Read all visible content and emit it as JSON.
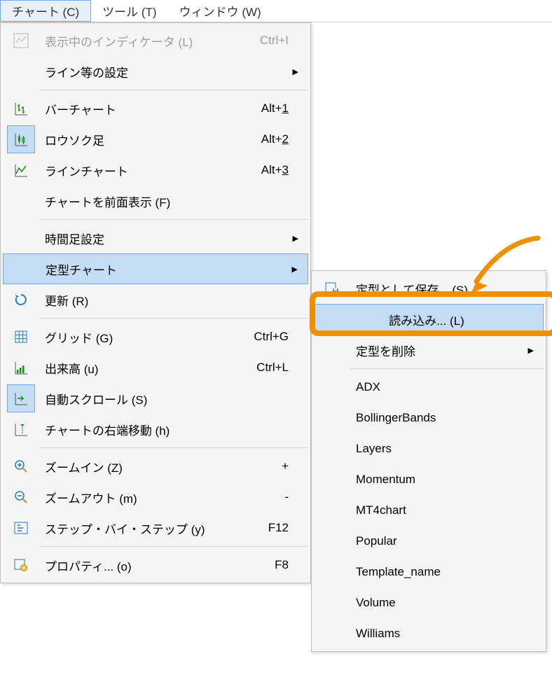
{
  "menubar": {
    "chart": "チャート (C)",
    "tools": "ツール (T)",
    "window": "ウィンドウ (W)"
  },
  "menu": {
    "indicators": {
      "label": "表示中のインディケータ (L)",
      "shortcut": "Ctrl+I"
    },
    "lineSettings": {
      "label": "ライン等の設定"
    },
    "barChart": {
      "label": "バーチャート",
      "shortcut_prefix": "Alt+",
      "shortcut_key": "1"
    },
    "candlestick": {
      "label": "ロウソク足",
      "shortcut_prefix": "Alt+",
      "shortcut_key": "2"
    },
    "lineChart": {
      "label": "ラインチャート",
      "shortcut_prefix": "Alt+",
      "shortcut_key": "3"
    },
    "foreground": {
      "label": "チャートを前面表示 (F)"
    },
    "timeframe": {
      "label": "時間足設定"
    },
    "template": {
      "label": "定型チャート"
    },
    "refresh": {
      "label": "更新 (R)"
    },
    "grid": {
      "label": "グリッド (G)",
      "shortcut": "Ctrl+G"
    },
    "volume": {
      "label": "出来高 (u)",
      "shortcut": "Ctrl+L"
    },
    "autoScroll": {
      "label": "自動スクロール (S)"
    },
    "chartShift": {
      "label": "チャートの右端移動 (h)"
    },
    "zoomIn": {
      "label": "ズームイン (Z)",
      "shortcut": "+"
    },
    "zoomOut": {
      "label": "ズームアウト (m)",
      "shortcut": "-"
    },
    "stepByStep": {
      "label": "ステップ・バイ・ステップ (y)",
      "shortcut": "F12"
    },
    "properties": {
      "label": "プロパティ... (o)",
      "shortcut": "F8"
    }
  },
  "submenu": {
    "saveTemplate": {
      "label": "定型として保存... (S)"
    },
    "loadTemplate": {
      "label": "読み込み... (L)"
    },
    "removeTemplate": {
      "label": "定型を削除"
    },
    "templates": [
      "ADX",
      "BollingerBands",
      "Layers",
      "Momentum",
      "MT4chart",
      "Popular",
      "Template_name",
      "Volume",
      "Williams"
    ]
  }
}
